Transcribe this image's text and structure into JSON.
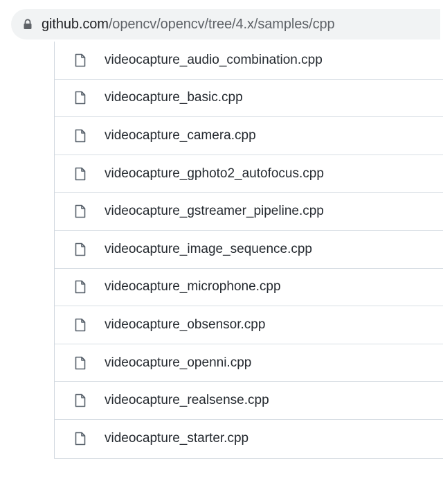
{
  "address_bar": {
    "lock_icon": "lock-icon",
    "host": "github.com",
    "path": "/opencv/opencv/tree/4.x/samples/cpp"
  },
  "file_list": {
    "file_icon": "file-icon",
    "items": [
      {
        "name": "videocapture_audio_combination.cpp"
      },
      {
        "name": "videocapture_basic.cpp"
      },
      {
        "name": "videocapture_camera.cpp"
      },
      {
        "name": "videocapture_gphoto2_autofocus.cpp"
      },
      {
        "name": "videocapture_gstreamer_pipeline.cpp"
      },
      {
        "name": "videocapture_image_sequence.cpp"
      },
      {
        "name": "videocapture_microphone.cpp"
      },
      {
        "name": "videocapture_obsensor.cpp"
      },
      {
        "name": "videocapture_openni.cpp"
      },
      {
        "name": "videocapture_realsense.cpp"
      },
      {
        "name": "videocapture_starter.cpp"
      }
    ]
  }
}
